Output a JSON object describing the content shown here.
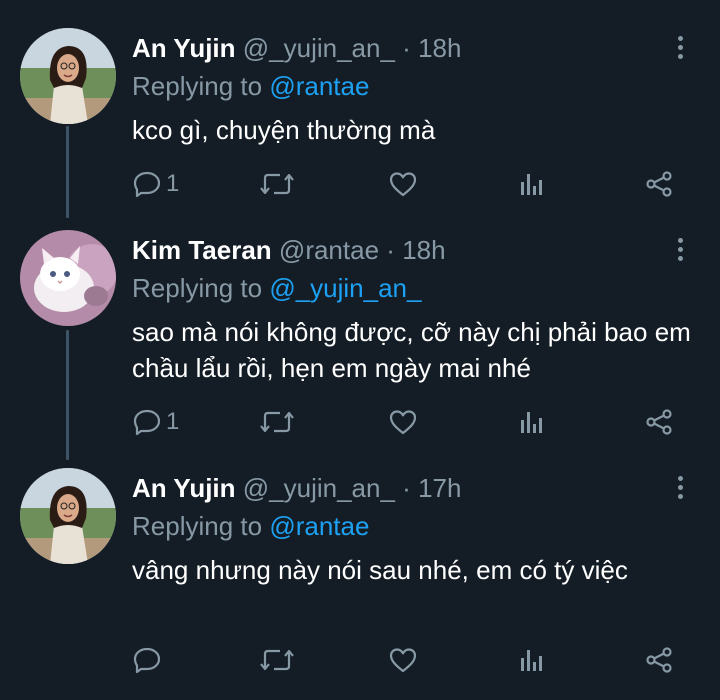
{
  "colors": {
    "background": "#141d26",
    "secondary_text": "#8899a6",
    "mention": "#1da1f2",
    "thread_line": "#3d5466"
  },
  "tweets": [
    {
      "display_name": "An Yujin",
      "handle": "@_yujin_an_",
      "separator": "·",
      "time": "18h",
      "replying_label": "Replying to",
      "reply_to": "@rantae",
      "text": "kco gì, chuyện thường mà",
      "reply_count": "1",
      "retweet_count": "",
      "like_count": "",
      "avatar_icon": "avatar-photo-icon"
    },
    {
      "display_name": "Kim Taeran",
      "handle": "@rantae",
      "separator": "·",
      "time": "18h",
      "replying_label": "Replying to",
      "reply_to": "@_yujin_an_",
      "text": "sao mà nói không được, cỡ này chị phải bao em chầu lẩu rồi, hẹn em ngày mai nhé",
      "reply_count": "1",
      "retweet_count": "",
      "like_count": "",
      "avatar_icon": "avatar-cat-icon"
    },
    {
      "display_name": "An Yujin",
      "handle": "@_yujin_an_",
      "separator": "·",
      "time": "17h",
      "replying_label": "Replying to",
      "reply_to": "@rantae",
      "text": "vâng nhưng này nói sau nhé, em có tý việc",
      "reply_count": "",
      "retweet_count": "",
      "like_count": "",
      "avatar_icon": "avatar-photo-icon"
    }
  ]
}
